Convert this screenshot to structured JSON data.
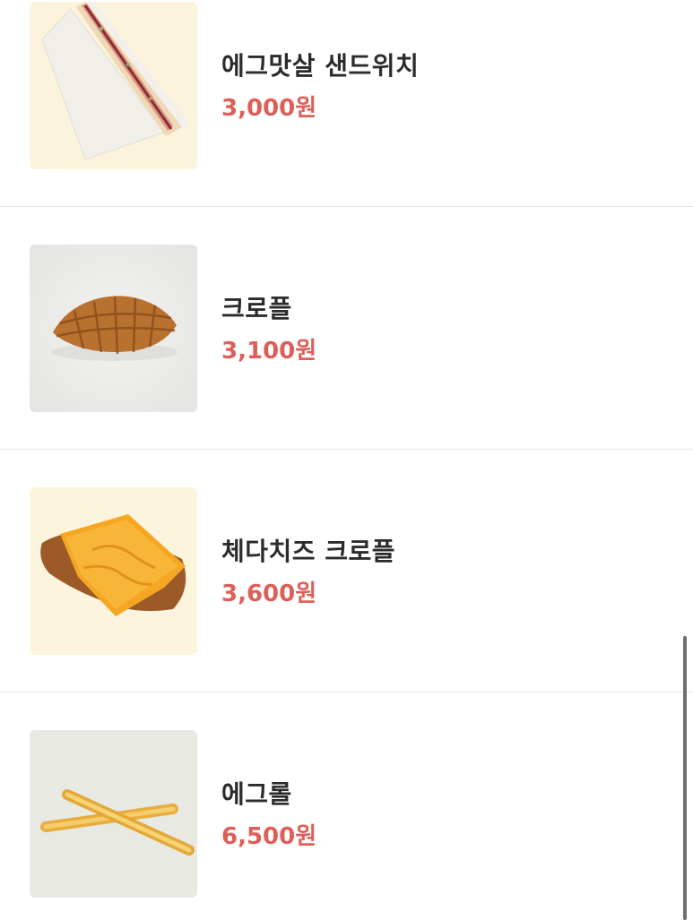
{
  "menu": {
    "items": [
      {
        "name": "에그맛살 샌드위치",
        "price": "3,000원",
        "image": "egg-crab-sandwich-image",
        "bg_color": "#fcf3dc"
      },
      {
        "name": "크로플",
        "price": "3,100원",
        "image": "croffle-image",
        "bg_color": "#ebebea"
      },
      {
        "name": "체다치즈 크로플",
        "price": "3,600원",
        "image": "cheddar-croffle-image",
        "bg_color": "#fdf4de"
      },
      {
        "name": "에그롤",
        "price": "6,500원",
        "image": "egg-roll-image",
        "bg_color": "#e9e9e4"
      }
    ]
  },
  "colors": {
    "price": "#de5f5a",
    "name": "#2b2b2b",
    "divider": "#e8e8e8",
    "scrollbar": "#6e6e6e"
  }
}
